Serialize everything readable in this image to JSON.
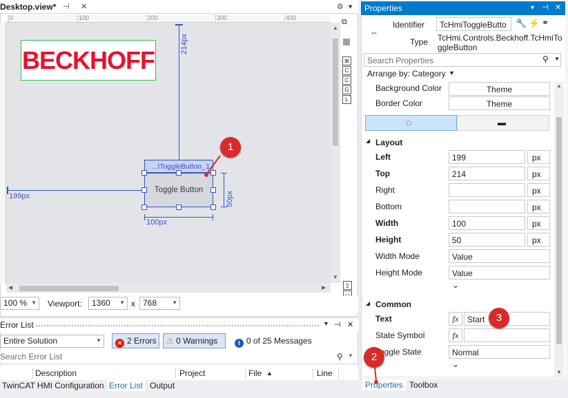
{
  "designer": {
    "tab_title": "Desktop.view*",
    "pin_icon": "pin-icon",
    "close_glyph": "✕",
    "ruler_labels": [
      "0",
      "100",
      "200",
      "300",
      "400"
    ],
    "logo_text": "BECKHOFF",
    "control": {
      "name_label": "...lToggleButton_1",
      "button_text": "Toggle Button",
      "left_label": "199px",
      "top_label": "214px",
      "width_label": "100px",
      "height_label": "50px"
    },
    "side_tool_labels": [
      "C",
      "C",
      "G",
      "L"
    ],
    "zoom": {
      "zoom_value": "100 %",
      "viewport_label": "Viewport:",
      "viewport_width": "1360",
      "times": "x",
      "viewport_height": "768"
    }
  },
  "errorlist": {
    "title": "Error List",
    "scope": "Entire Solution",
    "errors_label": "2 Errors",
    "warnings_label": "0 Warnings",
    "messages_label": "0 of 25 Messages",
    "search_placeholder": "Search Error List",
    "columns": [
      "Description",
      "Project",
      "File",
      "Line"
    ]
  },
  "bottom_tabs": [
    "TwinCAT HMI Configuration",
    "Error List",
    "Output"
  ],
  "properties": {
    "title": "Properties",
    "identifier_label": "Identifier",
    "identifier_value": "TcHmiToggleButto",
    "type_label": "Type",
    "type_value_line1": "TcHmi.Controls.Beckhoff.TcHmiTo",
    "type_value_line2": "ggleButton",
    "search_placeholder": "Search Properties",
    "arrange_label": "Arrange by:",
    "arrange_value": "Category",
    "rows_top": [
      {
        "label": "Background Color",
        "value": "Theme"
      },
      {
        "label": "Border Color",
        "value": "Theme"
      }
    ],
    "layout_group": "Layout",
    "layout_rows": [
      {
        "label": "Left",
        "value": "199",
        "unit": "px",
        "bold": true
      },
      {
        "label": "Top",
        "value": "214",
        "unit": "px",
        "bold": true
      },
      {
        "label": "Right",
        "value": "",
        "unit": "px",
        "bold": false
      },
      {
        "label": "Bottom",
        "value": "",
        "unit": "px",
        "bold": false
      },
      {
        "label": "Width",
        "value": "100",
        "unit": "px",
        "bold": true
      },
      {
        "label": "Height",
        "value": "50",
        "unit": "px",
        "bold": true
      }
    ],
    "width_mode_label": "Width Mode",
    "width_mode_value": "Value",
    "height_mode_label": "Height Mode",
    "height_mode_value": "Value",
    "common_group": "Common",
    "text_label": "Text",
    "text_value": "Start",
    "state_symbol_label": "State Symbol",
    "toggle_state_label": "Toggle State",
    "toggle_state_value": "Normal",
    "fx_label": "fx"
  },
  "props_tabs": [
    "Properties",
    "Toolbox"
  ],
  "badges": [
    "1",
    "2",
    "3"
  ],
  "colors": {
    "accent": "#007acc",
    "selection_blue": "#3553c9",
    "badge_red": "#d92a2a",
    "logo_red": "#e8112d"
  }
}
